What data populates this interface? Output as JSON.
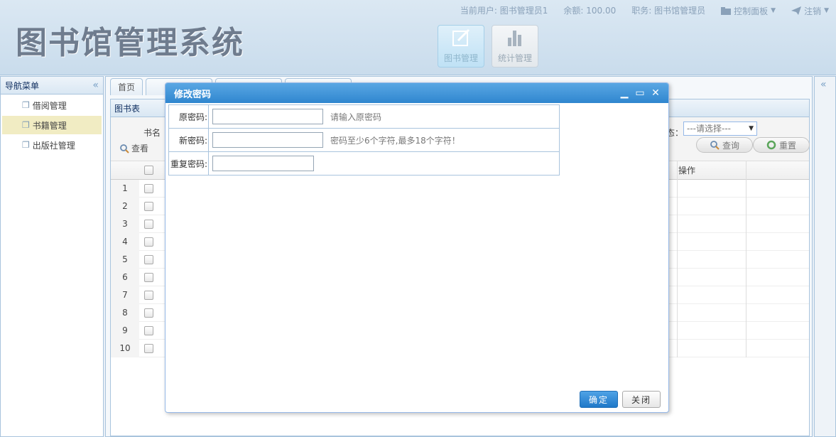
{
  "header": {
    "logo": "图书馆管理系统",
    "user_label": "当前用户:",
    "user_value": "图书管理员1",
    "balance_label": "余额:",
    "balance_value": "100.00",
    "role_label": "职务:",
    "role_value": "图书馆管理员",
    "control_panel": "控制面板",
    "logout": "注销",
    "tiles": [
      {
        "label": "图书管理",
        "icon": "edit-icon"
      },
      {
        "label": "统计管理",
        "icon": "bar-chart-icon"
      }
    ]
  },
  "leftnav": {
    "title": "导航菜单",
    "items": [
      {
        "label": "借阅管理"
      },
      {
        "label": "书籍管理"
      },
      {
        "label": "出版社管理"
      }
    ]
  },
  "center": {
    "tabs": [
      "首页"
    ],
    "grid_title": "图书表",
    "toolbar": {
      "book_name_label": "书名",
      "view_label": "查看",
      "status_label": "态：",
      "status_select": "---请选择---",
      "query_label": "查询",
      "reset_label": "重置"
    },
    "op_header": "操作",
    "row_numbers": [
      "1",
      "2",
      "3",
      "4",
      "5",
      "6",
      "7",
      "8",
      "9",
      "10"
    ]
  },
  "modal": {
    "title": "修改密码",
    "fields": [
      {
        "label": "原密码:",
        "hint": "请输入原密码"
      },
      {
        "label": "新密码:",
        "hint": "密码至少6个字符,最多18个字符！"
      },
      {
        "label": "重复密码:",
        "hint": ""
      }
    ],
    "ok_label": "确定",
    "close_label": "关闭"
  }
}
